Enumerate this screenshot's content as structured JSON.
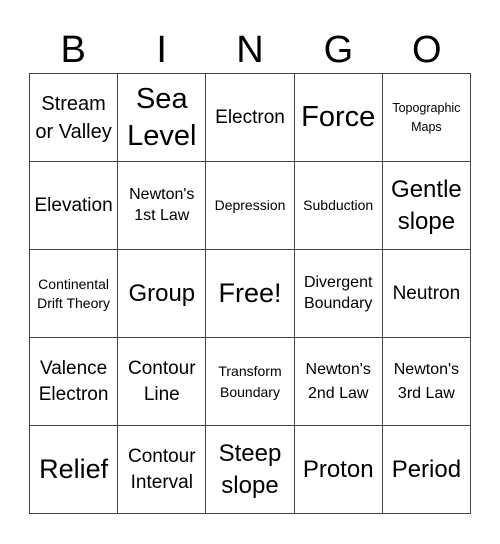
{
  "header": {
    "letters": [
      "B",
      "I",
      "N",
      "G",
      "O"
    ]
  },
  "board": {
    "cells": [
      [
        "Stream or Valley",
        "Sea Level",
        "Electron",
        "Force",
        "Topographic Maps"
      ],
      [
        "Elevation",
        "Newton's 1st Law",
        "Depression",
        "Subduction",
        "Gentle slope"
      ],
      [
        "Continental Drift Theory",
        "Group",
        "Free!",
        "Divergent Boundary",
        "Neutron"
      ],
      [
        "Valence Electron",
        "Contour Line",
        "Transform Boundary",
        "Newton's 2nd Law",
        "Newton's 3rd Law"
      ],
      [
        "Relief",
        "Contour Interval",
        "Steep slope",
        "Proton",
        "Period"
      ]
    ]
  }
}
